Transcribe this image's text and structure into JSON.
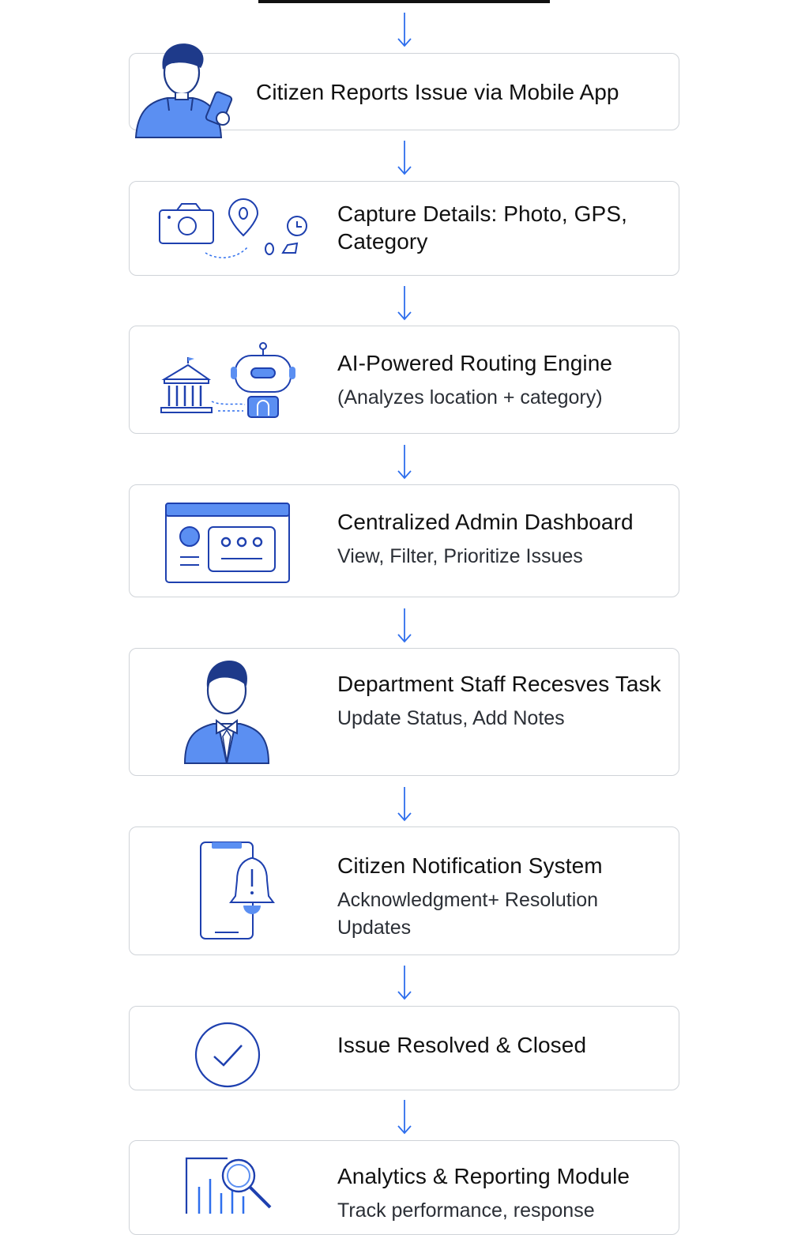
{
  "colors": {
    "accent": "#2F6FED",
    "fill": "#5B8FF2",
    "dark": "#1E3A8A",
    "border": "#CFD3D8"
  },
  "steps": [
    {
      "title": "Citizen Reports Issue via Mobile App",
      "icon": "citizen-phone-icon"
    },
    {
      "title": "Capture Details: Photo, GPS, Category",
      "icon": "camera-gps-icon"
    },
    {
      "title": "AI-Powered Routing Engine",
      "subtitle": "(Analyzes location + category)",
      "icon": "robot-building-icon"
    },
    {
      "title": "Centralized Admin Dashboard",
      "subtitle": "View, Filter, Prioritize Issues",
      "icon": "dashboard-icon"
    },
    {
      "title": "Department Staff Recesves Task",
      "subtitle": "Update Status, Add Notes",
      "icon": "staff-icon"
    },
    {
      "title": "Citizen Notification System",
      "subtitle": "Acknowledgment+ Resolution Updates",
      "icon": "phone-bell-icon"
    },
    {
      "title": "Issue Resolved & Closed",
      "icon": "check-circle-icon"
    },
    {
      "title": "Analytics & Reporting Module",
      "subtitle": "Track performance, response",
      "icon": "analytics-icon"
    }
  ]
}
